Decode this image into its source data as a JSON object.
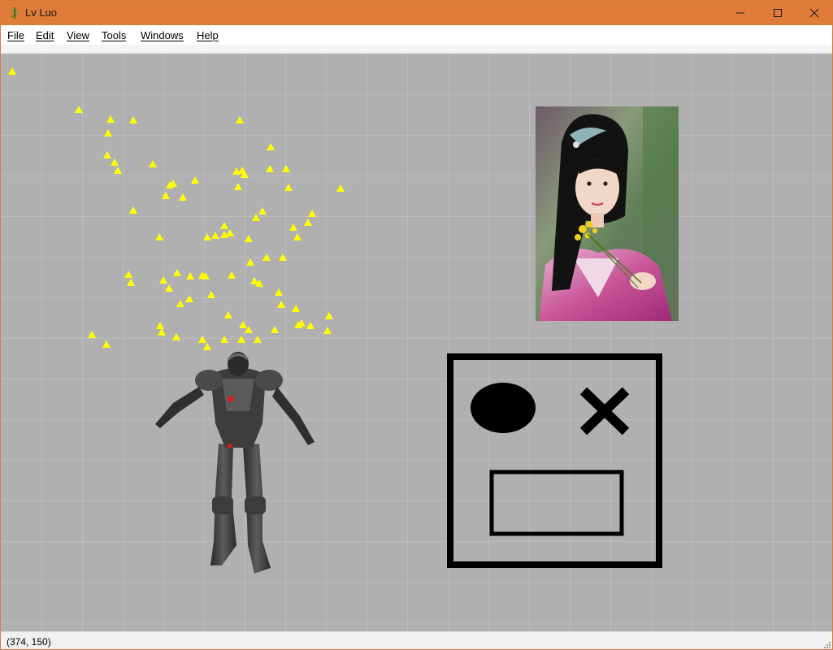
{
  "window": {
    "title": "Lv Luo",
    "app_icon": "bamboo-icon",
    "controls": [
      "minimize-icon",
      "maximize-icon",
      "close-icon"
    ],
    "accent_color": "#e07b39"
  },
  "menu": {
    "items": [
      {
        "label": "File"
      },
      {
        "label": "Edit"
      },
      {
        "label": "View"
      },
      {
        "label": "Tools"
      },
      {
        "label": "Windows"
      },
      {
        "label": "Help"
      }
    ]
  },
  "canvas": {
    "background_color": "#b0b0b0",
    "grid": true,
    "objects": [
      {
        "kind": "particle-field",
        "marker": "triangle",
        "color": "#ffff00"
      },
      {
        "kind": "photo",
        "subject": "woman in traditional Chinese hanfu holding yellow flowers"
      },
      {
        "kind": "character-model",
        "subject": "armored cyborg figure"
      },
      {
        "kind": "sprite",
        "subject": "face drawing with oval eye, x eye and rectangle mouth",
        "color": "#000000"
      }
    ]
  },
  "status": {
    "coordinates": "(374, 150)"
  }
}
